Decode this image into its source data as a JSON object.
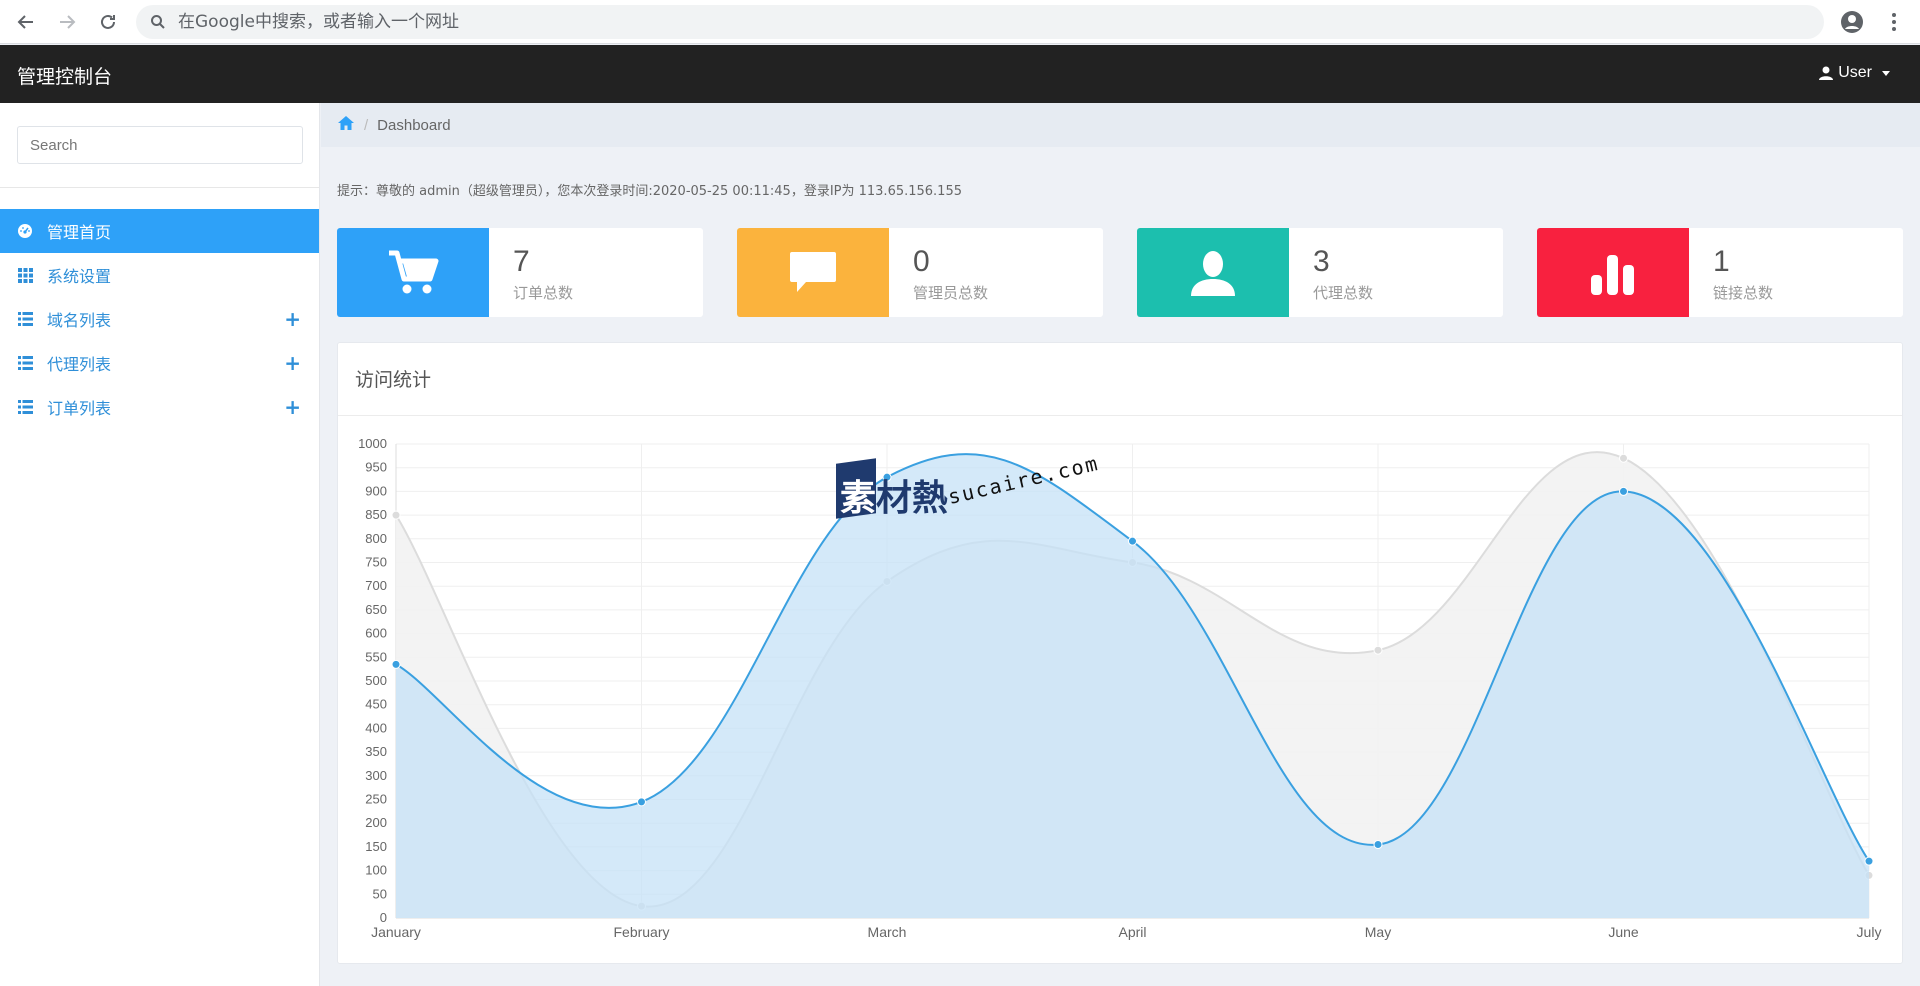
{
  "browser": {
    "omnibox_placeholder": "在Google中搜索，或者输入一个网址"
  },
  "header": {
    "brand": "管理控制台",
    "user_label": "User"
  },
  "sidebar": {
    "search_placeholder": "Search",
    "items": [
      {
        "label": "管理首页",
        "icon": "dashboard-icon",
        "active": true,
        "expandable": false
      },
      {
        "label": "系统设置",
        "icon": "grid-icon",
        "active": false,
        "expandable": false
      },
      {
        "label": "域名列表",
        "icon": "list-icon",
        "active": false,
        "expandable": true
      },
      {
        "label": "代理列表",
        "icon": "list-icon",
        "active": false,
        "expandable": true
      },
      {
        "label": "订单列表",
        "icon": "list-icon",
        "active": false,
        "expandable": true
      }
    ],
    "expand_symbol": "+"
  },
  "breadcrumb": {
    "home_icon": "home-icon",
    "separator": "/",
    "current": "Dashboard"
  },
  "tip": "提示：尊敬的 admin（超级管理员），您本次登录时间:2020-05-25 00:11:45，登录IP为 113.65.156.155",
  "stats": [
    {
      "value": "7",
      "label": "订单总数",
      "icon": "cart-icon",
      "color": "#2ea1f8"
    },
    {
      "value": "0",
      "label": "管理员总数",
      "icon": "comment-icon",
      "color": "#fbb33d"
    },
    {
      "value": "3",
      "label": "代理总数",
      "icon": "user-icon",
      "color": "#1cbfae"
    },
    {
      "value": "1",
      "label": "链接总数",
      "icon": "bar-chart-icon",
      "color": "#f8213f"
    }
  ],
  "panel": {
    "title": "访问统计"
  },
  "watermark": {
    "cn_first": "素",
    "cn_rest": "材熱",
    "en": "sucaire.com"
  },
  "chart_data": {
    "type": "area",
    "categories": [
      "January",
      "February",
      "March",
      "April",
      "May",
      "June",
      "July"
    ],
    "ylim": [
      0,
      1000
    ],
    "ytick_step": 50,
    "grid": true,
    "series": [
      {
        "values": [
          850,
          25,
          710,
          750,
          565,
          970,
          90
        ],
        "color": "#dcdcdc",
        "fill": "#f2f2f2"
      },
      {
        "values": [
          535,
          245,
          930,
          795,
          155,
          900,
          120
        ],
        "color": "#3aa0e0",
        "fill": "#c5e2f7"
      }
    ]
  }
}
